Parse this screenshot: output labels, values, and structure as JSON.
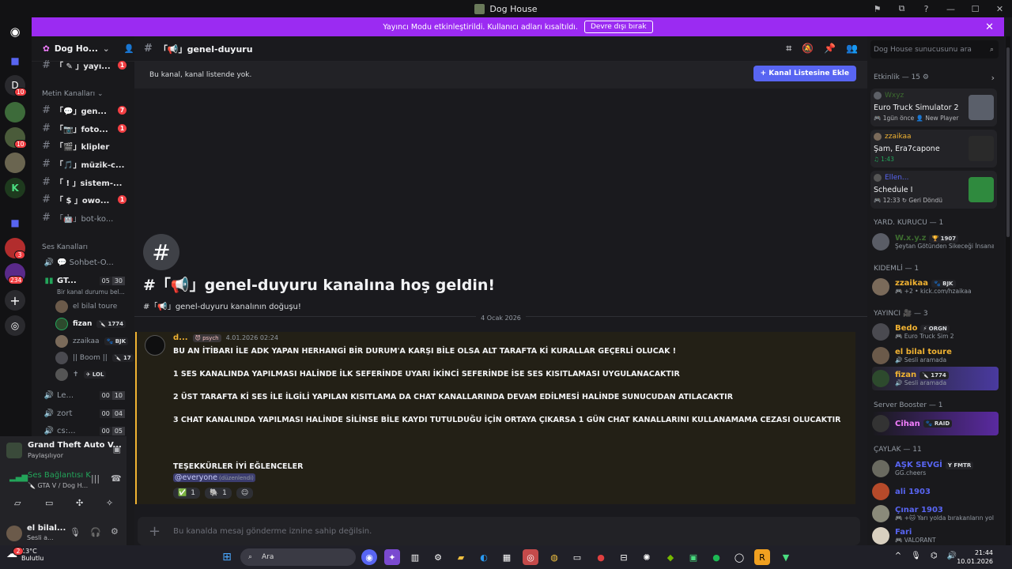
{
  "window": {
    "title": "Dog House",
    "controls": [
      "⚑",
      "⧉",
      "?",
      "—",
      "☐",
      "✕"
    ]
  },
  "banner": {
    "text": "Yayıncı Modu etkinleştirildi. Kullanıcı adları kısaltıldı.",
    "button": "Devre dışı bırak"
  },
  "servers": {
    "badges": [
      "10",
      "10",
      "3",
      "234"
    ]
  },
  "guild": {
    "name": "Dog Ho..."
  },
  "sidebar": {
    "top_channel": {
      "name": "「 ✎ 」yayı...",
      "badge": "1"
    },
    "text_category": "Metin Kanalları ⌄",
    "text_channels": [
      {
        "name": "「💬」gen...",
        "badge": "7"
      },
      {
        "name": "「📷」foto...",
        "badge": "1"
      },
      {
        "name": "「🎬」klipler",
        "badge": ""
      },
      {
        "name": "「🎵」müzik-c...",
        "badge": ""
      },
      {
        "name": "「 ! 」sistem-...",
        "badge": ""
      },
      {
        "name": "「 $ 」owo...",
        "badge": "1"
      },
      {
        "name": "「🤖」bot-ko...",
        "badge": ""
      }
    ],
    "voice_category": "Ses Kanalları",
    "voice_channels": [
      {
        "name": "💬 Sohbet-O...",
        "a": "",
        "b": ""
      },
      {
        "name": "GT...",
        "a": "05",
        "b": "30"
      }
    ],
    "voice_status": "Bir kanal durumu bel...",
    "voice_users": [
      {
        "name": "el bilal toure",
        "extra": ""
      },
      {
        "name": "fizan",
        "extra": "🔪 1774"
      },
      {
        "name": "zzaikaa",
        "extra": "🐾 BJK"
      },
      {
        "name": "|| Boom ||",
        "extra": "🔪 17"
      },
      {
        "name": "✝",
        "extra": "✈ LOL"
      }
    ],
    "more_voice": [
      {
        "name": "Le...",
        "a": "00",
        "b": "10"
      },
      {
        "name": "zort",
        "a": "00",
        "b": "04"
      },
      {
        "name": "cs:...",
        "a": "00",
        "b": "05"
      }
    ]
  },
  "activity_panel": {
    "title": "Grand Theft Auto V...",
    "sub": "Paylaşılıyor"
  },
  "voice_panel": {
    "status": "Ses Bağlantısı K",
    "channel": "🔪 GTA V / Dog H..."
  },
  "user_panel": {
    "name": "el bilal...",
    "status": "Sesli a..."
  },
  "channel": {
    "header": "「📢」genel-duyuru",
    "notice": "Bu kanal, kanal listende yok.",
    "notice_button": "+ Kanal Listesine Ekle",
    "welcome_title": "#「📢」genel-duyuru kanalına hoş geldin!",
    "welcome_sub": "#「📢」genel-duyuru kanalının doğuşu!",
    "date_divider": "4 Ocak 2026",
    "composer": "Bu kanalda mesaj gönderme iznine sahip değilsin."
  },
  "message": {
    "author": "d...",
    "tag": "😈 psych",
    "timestamp": "4.01.2026 02:24",
    "lines": [
      "BU AN İTİBARI İLE ADK YAPAN HERHANGİ BİR DURUM'A KARŞI BİLE OLSA ALT TARAFTA Kİ KURALLAR GEÇERLİ OLUCAK !",
      "1 SES KANALINDA YAPILMASI HALİNDE İLK SEFERİNDE UYARI İKİNCİ SEFERİNDE İSE SES KISITLAMASI UYGULANACAKTIR",
      "2 ÜST TARAFTA Kİ SES İLE İLGİLİ YAPILAN KISITLAMA DA CHAT KANALLARINDA DEVAM EDİLMESİ HALİNDE SUNUCUDAN ATILACAKTIR",
      "3 CHAT KANALINDA YAPILMASI HALİNDE SİLİNSE BİLE KAYDI TUTULDUĞU İÇİN ORTAYA ÇIKARSA 1 GÜN CHAT KANALLARINI KULLANAMAMA CEZASI OLUCAKTIR",
      "TEŞEKKÜRLER İYİ EĞLENCELER"
    ],
    "mention": "@everyone",
    "edited": "(düzenlendi)",
    "reactions": [
      {
        "emoji": "✅",
        "count": "1"
      },
      {
        "emoji": "🐘",
        "count": "1"
      },
      {
        "emoji": "☺",
        "count": ""
      }
    ]
  },
  "right": {
    "search_placeholder": "Dog House sunucusunu ara",
    "activity_header": "Etkinlik — 15 ⚙",
    "cards": [
      {
        "user": "W​xy​z",
        "title": "Euro Truck Simulator 2",
        "sub": "🎮 1gün önce  👤 New Player"
      },
      {
        "user": "zzaikaa",
        "title": "Şam, Era7capone",
        "sub": "♫ 1:43"
      },
      {
        "user": "Ellen...",
        "title": "Schedule I",
        "sub": "🎮 12:33  ↻ Geri Döndü"
      }
    ],
    "groups": [
      {
        "header": "YARD. KURUCU — 1",
        "members": [
          {
            "name": "W.x.y.z",
            "role": "🏆 1907",
            "status": "Şeytan Götünden Sikeceği İnsana ...",
            "color": "#3c6b2f"
          }
        ]
      },
      {
        "header": "KIDEMLİ — 1",
        "members": [
          {
            "name": "zzaikaa",
            "role": "🐾 BJK",
            "status": "🎮 +2 • kick.com/hzaikaa",
            "color": "#f0b232"
          }
        ]
      },
      {
        "header": "YAYINCI 🎥 — 3",
        "members": [
          {
            "name": "Bedo",
            "role": "⚡ ORGN",
            "status": "🎮 Euro Truck Sim 2",
            "color": "#f0b232"
          },
          {
            "name": "el bilal toure",
            "role": "",
            "status": "🔊 Sesli aramada",
            "color": "#f0b232"
          },
          {
            "name": "fizan",
            "role": "🔪 1774",
            "status": "🔊 Sesli aramada",
            "color": "#f0b232"
          }
        ]
      },
      {
        "header": "Server Booster — 1",
        "members": [
          {
            "name": "Cihan",
            "role": "🐾 RAID",
            "status": "",
            "color": "#f47fff"
          }
        ]
      },
      {
        "header": "ÇAYLAK — 11",
        "members": [
          {
            "name": "AŞK SEVGİ",
            "role": "Y FMTR",
            "status": "GG.cheers",
            "color": "#5865f2"
          },
          {
            "name": "ali 1903",
            "role": "",
            "status": "",
            "color": "#5865f2"
          },
          {
            "name": "Çınar 1903",
            "role": "",
            "status": "🎮 +🐱 Yarı yolda bırakanların yol...",
            "color": "#5865f2"
          },
          {
            "name": "Fari",
            "role": "",
            "status": "🎮 VALORANT",
            "color": "#5865f2"
          }
        ]
      }
    ]
  },
  "taskbar": {
    "weather_temp": "13°C",
    "weather_desc": "Bulutlu",
    "search": "Ara",
    "time": "21:44",
    "date": "10.01.2026",
    "notif": "2"
  }
}
